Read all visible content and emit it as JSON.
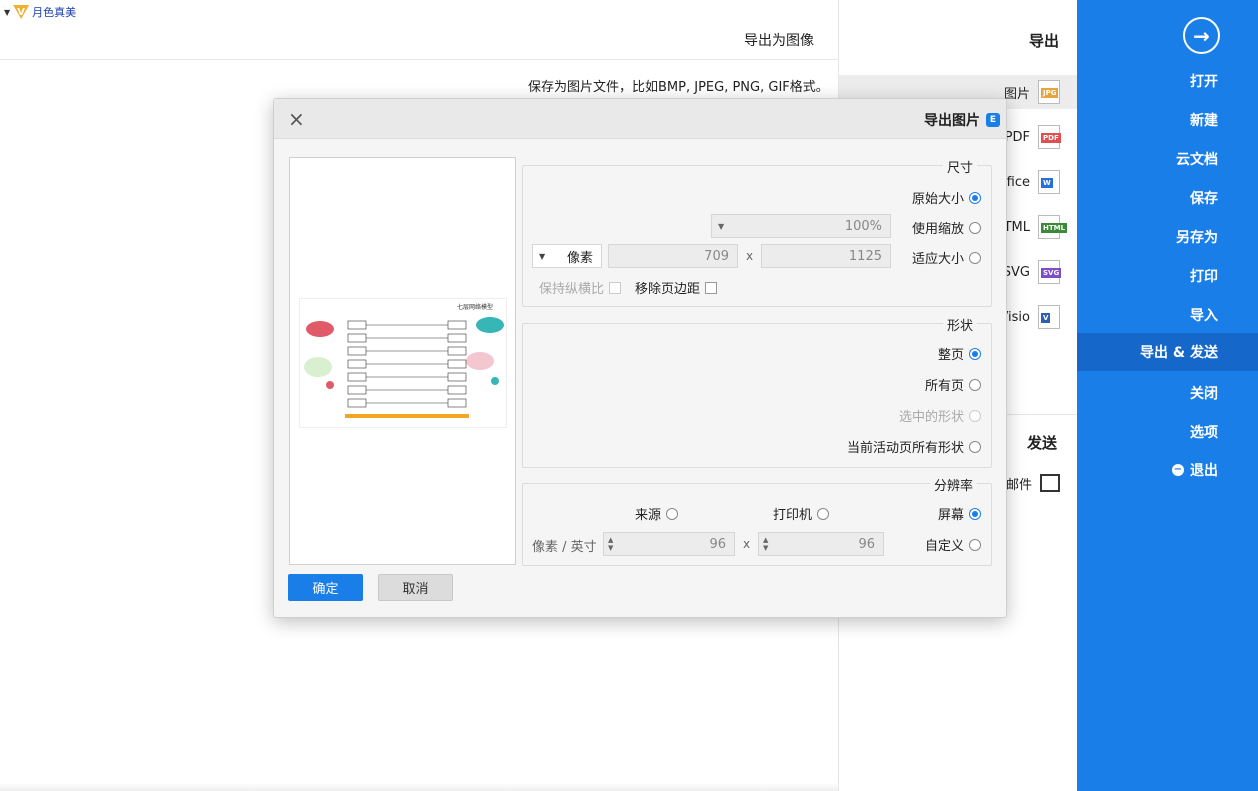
{
  "brand": {
    "label": "月色真美"
  },
  "sidebar": {
    "items": [
      {
        "label": "打开"
      },
      {
        "label": "新建"
      },
      {
        "label": "云文档"
      },
      {
        "label": "保存"
      },
      {
        "label": "另存为"
      },
      {
        "label": "打印"
      },
      {
        "label": "导入"
      },
      {
        "label": "导出 & 发送"
      },
      {
        "label": "关闭"
      },
      {
        "label": "选项"
      },
      {
        "label": "退出"
      }
    ]
  },
  "export_panel": {
    "title": "导出",
    "formats": [
      {
        "label": "图片",
        "badge": "JPG",
        "color": "#e8a33b"
      },
      {
        "label": "PDF",
        "badge": "PDF",
        "color": "#e05050"
      },
      {
        "label": "Office",
        "badge": "W",
        "color": "#2b6fd6"
      },
      {
        "label": "HTML",
        "badge": "HTML",
        "color": "#3a8a3a"
      },
      {
        "label": "SVG",
        "badge": "SVG",
        "color": "#7a4fc8"
      },
      {
        "label": "Visio",
        "badge": "V",
        "color": "#2b5fb0"
      }
    ],
    "send_title": "发送",
    "send_item": "发送邮件"
  },
  "main": {
    "title": "导出为图像",
    "description": "保存为图片文件，比如BMP, JPEG, PNG, GIF格式。"
  },
  "dialog": {
    "title": "导出图片",
    "size": {
      "legend": "尺寸",
      "original": "原始大小",
      "zoom": "使用缩放",
      "zoom_value": "100%",
      "fit": "适应大小",
      "width": "1125",
      "height": "709",
      "unit": "像素",
      "remove_margin": "移除页边距",
      "keep_ratio": "保持纵横比"
    },
    "shape": {
      "legend": "形状",
      "whole_page": "整页",
      "all_pages": "所有页",
      "selected": "选中的形状",
      "current_page": "当前活动页所有形状"
    },
    "resolution": {
      "legend": "分辨率",
      "screen": "屏幕",
      "printer": "打印机",
      "source": "来源",
      "custom": "自定义",
      "dpi_x": "96",
      "dpi_y": "96",
      "unit": "像素 / 英寸"
    },
    "ok": "确定",
    "cancel": "取消",
    "preview_title": "七层网络模型"
  }
}
